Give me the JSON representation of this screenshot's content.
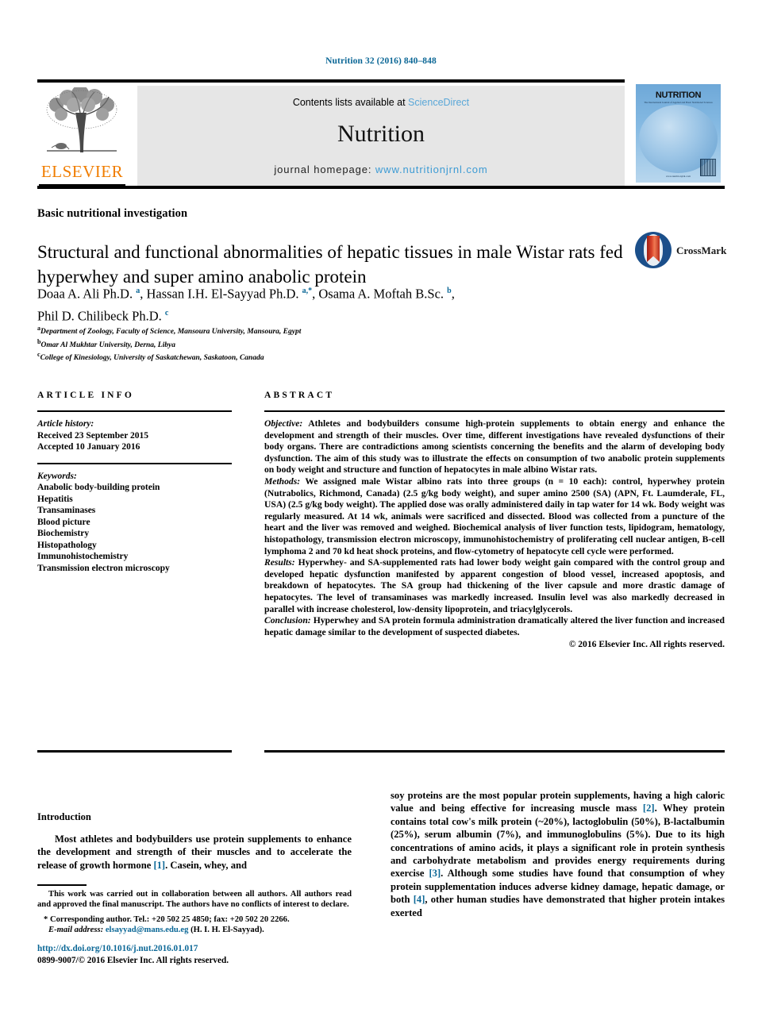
{
  "running_head": "Nutrition 32 (2016) 840–848",
  "header": {
    "elsevier_wordmark": "ELSEVIER",
    "contents_prefix": "Contents lists available at ",
    "contents_link": "ScienceDirect",
    "journal_title": "Nutrition",
    "homepage_prefix": "journal homepage: ",
    "homepage_url": "www.nutritionjrnl.com",
    "cover_masthead": "NUTRITION",
    "cover_subtitle": "The International Journal of Applied and Basic Nutritional Sciences",
    "cover_footer": "www.nutritionjrnl.com"
  },
  "article": {
    "type": "Basic nutritional investigation",
    "title": "Structural and functional abnormalities of hepatic tissues in male Wistar rats fed hyperwhey and super amino anabolic protein",
    "crossmark_label": "CrossMark",
    "authors_line_1": "Doaa A. Ali Ph.D. <sup>a</sup>, Hassan I.H. El-Sayyad Ph.D. <sup>a,*</sup>, Osama A. Moftah B.Sc. <sup>b</sup>,",
    "authors_line_2": "Phil D. Chilibeck Ph.D. <sup>c</sup>",
    "affiliations": [
      {
        "marker": "a",
        "text": "Department of Zoology, Faculty of Science, Mansoura University, Mansoura, Egypt"
      },
      {
        "marker": "b",
        "text": "Omar Al Mukhtar University, Derna, Libya"
      },
      {
        "marker": "c",
        "text": "College of Kinesiology, University of Saskatchewan, Saskatoon, Canada"
      }
    ]
  },
  "article_info": {
    "heading": "ARTICLE INFO",
    "history_label": "Article history:",
    "received": "Received 23 September 2015",
    "accepted": "Accepted 10 January 2016",
    "keywords_label": "Keywords:",
    "keywords": [
      "Anabolic body-building protein",
      "Hepatitis",
      "Transaminases",
      "Blood picture",
      "Biochemistry",
      "Histopathology",
      "Immunohistochemistry",
      "Transmission electron microscopy"
    ]
  },
  "abstract": {
    "heading": "ABSTRACT",
    "objective_label": "Objective:",
    "objective_text": " Athletes and bodybuilders consume high-protein supplements to obtain energy and enhance the development and strength of their muscles. Over time, different investigations have revealed dysfunctions of their body organs. There are contradictions among scientists concerning the benefits and the alarm of developing body dysfunction. The aim of this study was to illustrate the effects on consumption of two anabolic protein supplements on body weight and structure and function of hepatocytes in male albino Wistar rats.",
    "methods_label": "Methods:",
    "methods_text": " We assigned male Wistar albino rats into three groups (n = 10 each): control, hyperwhey protein (Nutrabolics, Richmond, Canada) (2.5 g/kg body weight), and super amino 2500 (SA) (APN, Ft. Laumderale, FL, USA) (2.5 g/kg body weight). The applied dose was orally administered daily in tap water for 14 wk. Body weight was regularly measured. At 14 wk, animals were sacrificed and dissected. Blood was collected from a puncture of the heart and the liver was removed and weighed. Biochemical analysis of liver function tests, lipidogram, hematology, histopathology, transmission electron microscopy, immunohistochemistry of proliferating cell nuclear antigen, B-cell lymphoma 2 and 70 kd heat shock proteins, and flow-cytometry of hepatocyte cell cycle were performed.",
    "results_label": "Results:",
    "results_text": " Hyperwhey- and SA-supplemented rats had lower body weight gain compared with the control group and developed hepatic dysfunction manifested by apparent congestion of blood vessel, increased apoptosis, and breakdown of hepatocytes. The SA group had thickening of the liver capsule and more drastic damage of hepatocytes. The level of transaminases was markedly increased. Insulin level was also markedly decreased in parallel with increase cholesterol, low-density lipoprotein, and triacylglycerols.",
    "conclusion_label": "Conclusion:",
    "conclusion_text": " Hyperwhey and SA protein formula administration dramatically altered the liver function and increased hepatic damage similar to the development of suspected diabetes.",
    "copyright": "© 2016 Elsevier Inc. All rights reserved."
  },
  "introduction": {
    "heading": "Introduction",
    "para_left_1": "Most athletes and bodybuilders use protein supplements to enhance the development and strength of their muscles and to accelerate the release of growth hormone ",
    "ref_1": "[1]",
    "para_left_1b": ". Casein, whey, and",
    "para_right_1": "soy proteins are the most popular protein supplements, having a high caloric value and being effective for increasing muscle mass ",
    "ref_2": "[2]",
    "para_right_1b": ". Whey protein contains total cow's milk protein (~20%), lactoglobulin (50%), B-lactalbumin (25%), serum albumin (7%), and immunoglobulins (5%). Due to its high concentrations of amino acids, it plays a significant role in protein synthesis and carbohydrate metabolism and provides energy requirements during exercise ",
    "ref_3": "[3]",
    "para_right_1c": ". Although some studies have found that consumption of whey protein supplementation induces adverse kidney damage, hepatic damage, or both ",
    "ref_4": "[4]",
    "para_right_1d": ", other human studies have demonstrated that higher protein intakes exerted"
  },
  "footnotes": {
    "statement": "This work was carried out in collaboration between all authors. All authors read and approved the final manuscript. The authors have no conflicts of interest to declare.",
    "corresponding_marker": "*",
    "corresponding": " Corresponding author. Tel.: +20 502 25 4850; fax: +20 502 20 2266.",
    "email_label": "E-mail address:",
    "email": "elsayyad@mans.edu.eg",
    "email_suffix": " (H. I. H. El-Sayyad).",
    "doi": "http://dx.doi.org/10.1016/j.nut.2016.01.017",
    "issn_line": "0899-9007/© 2016 Elsevier Inc. All rights reserved."
  },
  "colors": {
    "link_blue": "#0b6796",
    "sciencedirect_blue": "#5aa7d8",
    "elsevier_orange": "#f07d00",
    "band_gray": "#e6e6e6"
  }
}
